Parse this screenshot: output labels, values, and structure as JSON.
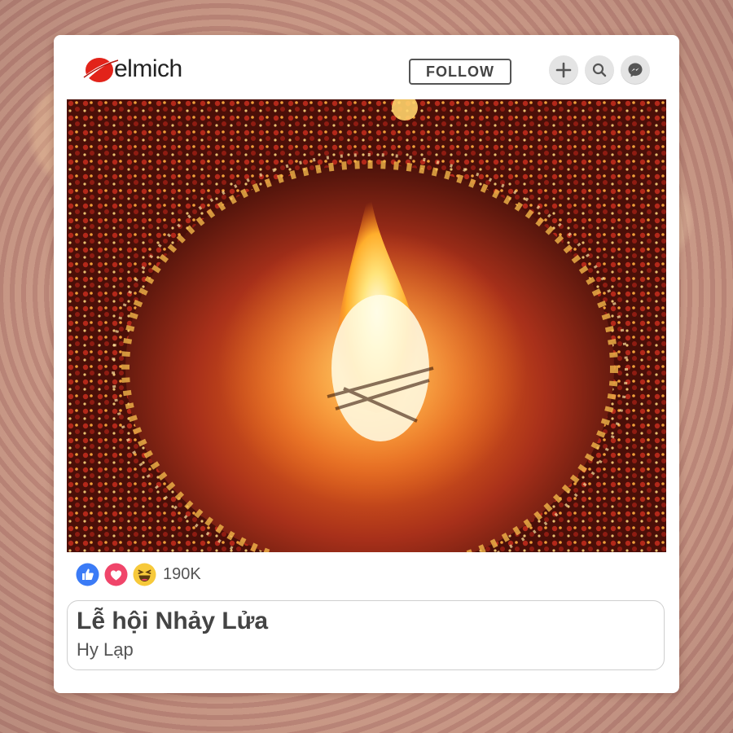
{
  "brand": {
    "name": "elmich",
    "accent": "#e2231a"
  },
  "header": {
    "follow_label": "FOLLOW",
    "icons": [
      "plus-icon",
      "search-icon",
      "messenger-icon"
    ]
  },
  "reactions": {
    "icons": [
      "like-icon",
      "love-icon",
      "haha-icon"
    ],
    "count": "190K"
  },
  "post": {
    "title": "Lễ hội Nhảy Lửa",
    "location": "Hy Lạp"
  },
  "colors": {
    "fire": "#ffd36b",
    "ground": "#c44a1a",
    "crowd": "#5a1409"
  }
}
